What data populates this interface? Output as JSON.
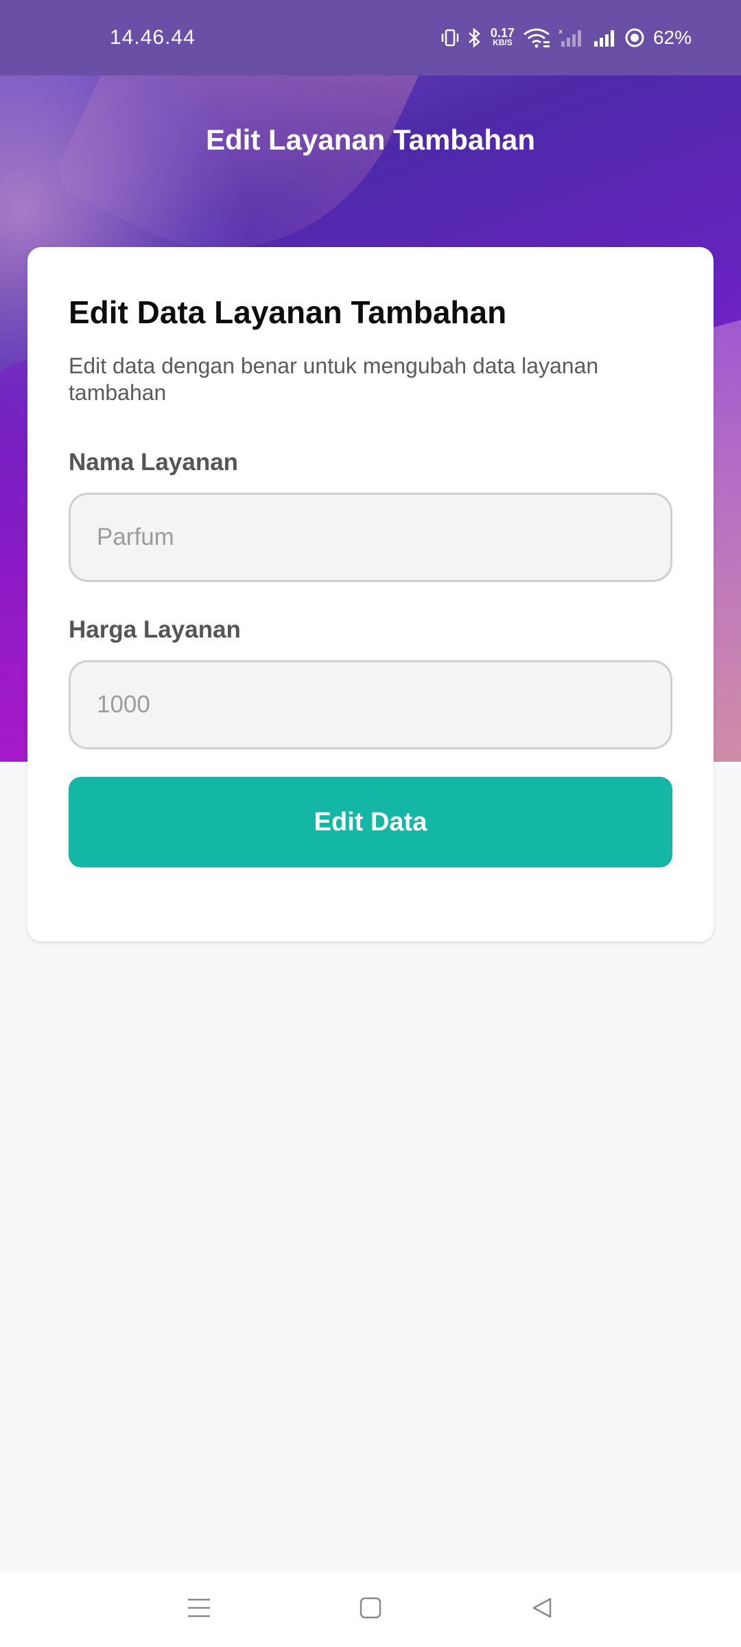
{
  "status_bar": {
    "time": "14.46.44",
    "net_speed_value": "0.17",
    "net_speed_unit": "KB/S",
    "battery": "62%"
  },
  "header": {
    "title": "Edit Layanan Tambahan"
  },
  "form": {
    "title": "Edit Data Layanan Tambahan",
    "subtitle": "Edit data dengan benar untuk mengubah data layanan tambahan",
    "name_label": "Nama Layanan",
    "name_placeholder": "Parfum",
    "price_label": "Harga Layanan",
    "price_placeholder": "1000",
    "submit_label": "Edit Data"
  },
  "colors": {
    "accent": "#14b7a5",
    "status_bar": "#6a4fa6"
  },
  "nav_bar": {
    "icons": [
      "menu-icon",
      "home-square-icon",
      "back-triangle-icon"
    ]
  }
}
